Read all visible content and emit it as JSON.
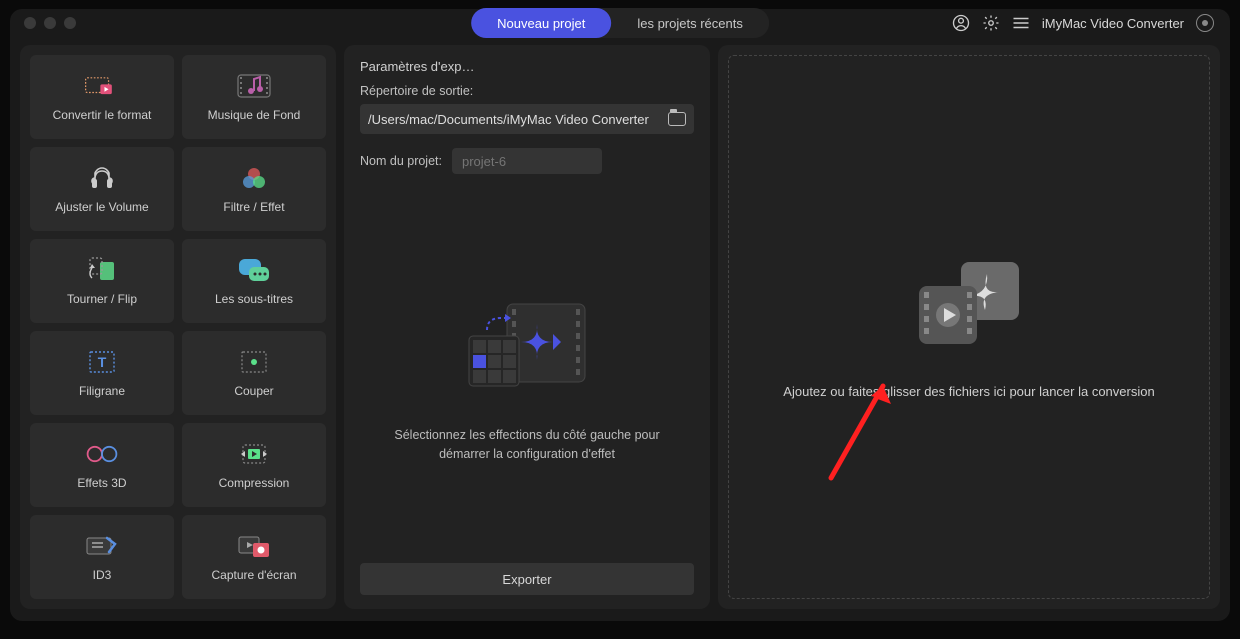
{
  "header": {
    "tabs": {
      "new_project": "Nouveau projet",
      "recent_projects": "les projets récents"
    },
    "app_title": "iMyMac Video Converter"
  },
  "tools": {
    "convert_format": "Convertir le format",
    "background_music": "Musique de Fond",
    "adjust_volume": "Ajuster le Volume",
    "filter_effect": "Filtre / Effet",
    "rotate_flip": "Tourner / Flip",
    "subtitles": "Les sous-titres",
    "watermark": "Filigrane",
    "cut": "Couper",
    "effects_3d": "Effets 3D",
    "compression": "Compression",
    "id3": "ID3",
    "screenshot": "Capture d'écran"
  },
  "middle": {
    "title": "Paramètres d'exp…",
    "output_dir_label": "Répertoire de sortie:",
    "output_dir_value": "/Users/mac/Documents/iMyMac Video Converter",
    "project_name_label": "Nom du projet:",
    "project_name_placeholder": "projet-6",
    "hint": "Sélectionnez les effections du côté gauche pour démarrer la configuration d'effet",
    "export_button": "Exporter"
  },
  "drop": {
    "hint": "Ajoutez ou faites glisser des fichiers ici pour lancer la conversion"
  }
}
